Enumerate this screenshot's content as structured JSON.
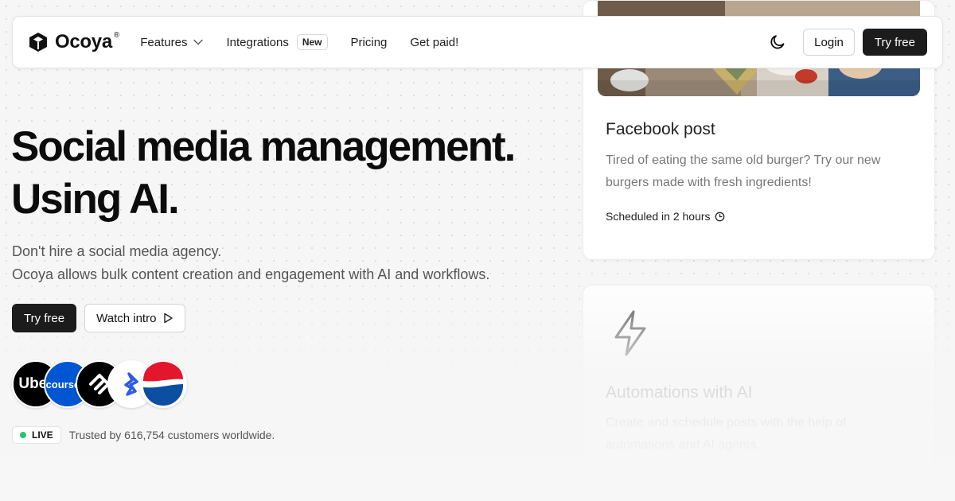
{
  "nav": {
    "brand": "Ocoya",
    "brand_reg": "®",
    "links": [
      {
        "label": "Features",
        "has_dropdown": true
      },
      {
        "label": "Integrations",
        "badge": "New"
      },
      {
        "label": "Pricing"
      },
      {
        "label": "Get paid!"
      }
    ],
    "theme_icon": "moon-icon",
    "login_label": "Login",
    "try_label": "Try free"
  },
  "hero": {
    "title_line1": "Social media management.",
    "title_line2": "Using AI.",
    "subtitle_line1": "Don't hire a social media agency.",
    "subtitle_line2": "Ocoya allows bulk content creation and engagement with AI and workflows.",
    "primary_button": "Try free",
    "secondary_button": "Watch intro",
    "brands": [
      {
        "name": "Uber",
        "label": "Uber"
      },
      {
        "name": "Coursera",
        "label": "coursera"
      },
      {
        "name": "Squarespace",
        "label": ""
      },
      {
        "name": "Toptal",
        "label": ""
      },
      {
        "name": "Pepsi",
        "label": ""
      }
    ],
    "live_label": "LIVE",
    "trusted_text": "Trusted by 616,754 customers worldwide."
  },
  "cards": {
    "facebook": {
      "title": "Facebook post",
      "text": "Tired of eating the same old burger? Try our new burgers made with fresh ingredients!",
      "scheduled": "Scheduled in 2 hours"
    },
    "automations": {
      "title": "Automations with AI",
      "text": "Create and schedule posts with the help of automations and AI agents."
    }
  },
  "colors": {
    "dark_button": "#1c1c1c",
    "live_dot": "#27c766",
    "page_bg": "#f6f6f6"
  }
}
